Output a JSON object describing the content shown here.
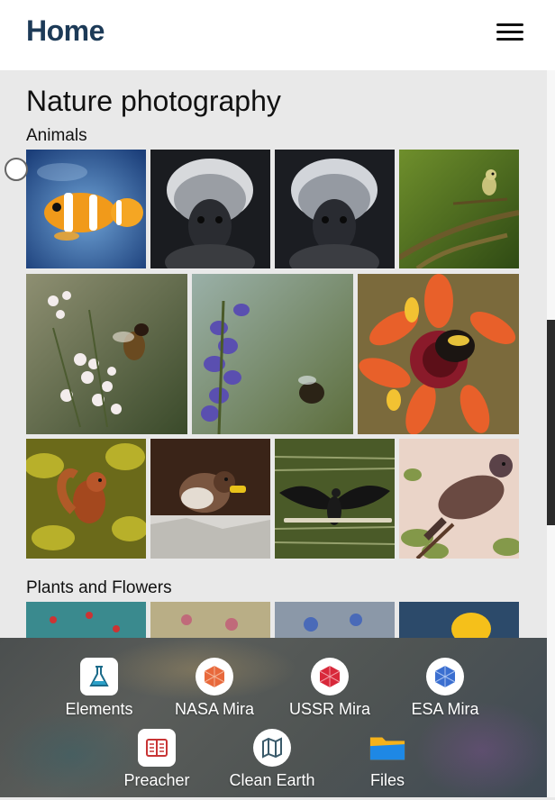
{
  "header": {
    "title": "Home",
    "menu_icon": "hamburger-menu-icon"
  },
  "page": {
    "heading": "Nature photography"
  },
  "sections": [
    {
      "title": "Animals"
    },
    {
      "title": "Plants and Flowers"
    }
  ],
  "animals_photos": [
    "clownfish",
    "tamarin monkey",
    "tamarin monkey",
    "small bird on branch",
    "bee on white flowers",
    "bee on purple flowers",
    "bumblebee on orange flower",
    "squirrel in leaves",
    "sparrow",
    "cormorant spreading wings",
    "pigeon"
  ],
  "plants_photos": [
    "red berries",
    "pink blossoms",
    "blue flowers",
    "yellow flower"
  ],
  "dock": {
    "apps": [
      {
        "label": "Elements",
        "icon": "flask-icon"
      },
      {
        "label": "NASA Mira",
        "icon": "nasa-mira-icon"
      },
      {
        "label": "USSR Mira",
        "icon": "ussr-mira-icon"
      },
      {
        "label": "ESA Mira",
        "icon": "esa-mira-icon"
      },
      {
        "label": "Preacher",
        "icon": "book-icon"
      },
      {
        "label": "Clean Earth",
        "icon": "map-icon"
      },
      {
        "label": "Files",
        "icon": "folder-icon"
      }
    ]
  },
  "colors": {
    "title": "#1c3a57",
    "nasa": "#e8693c",
    "ussr": "#d8283a",
    "esa": "#3b6fd0",
    "preacher": "#c83434",
    "files": "#1e88e5"
  }
}
